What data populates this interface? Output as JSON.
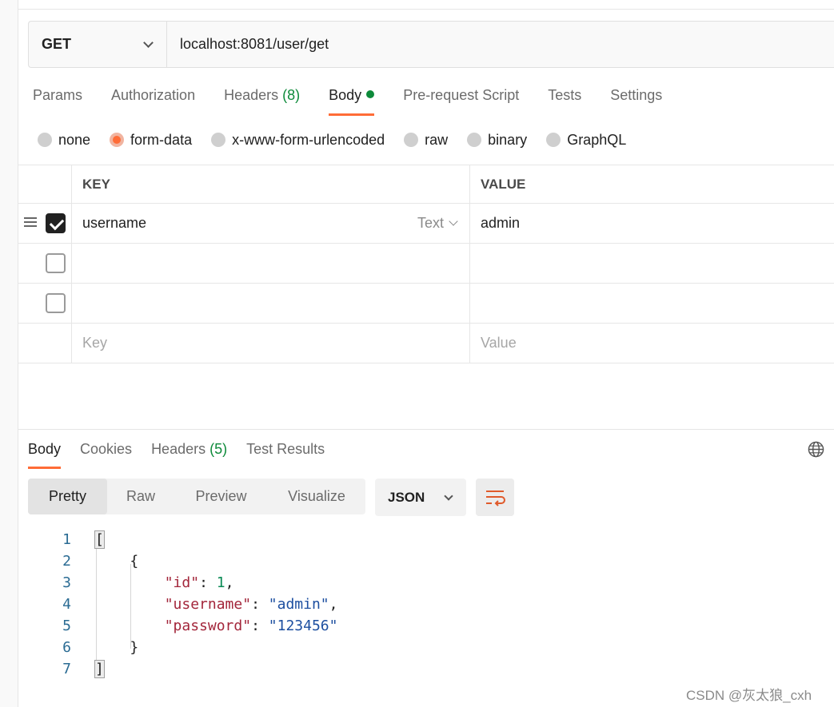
{
  "request": {
    "method": "GET",
    "url": "localhost:8081/user/get"
  },
  "request_tabs": [
    {
      "label": "Params"
    },
    {
      "label": "Authorization"
    },
    {
      "label": "Headers",
      "count": "(8)"
    },
    {
      "label": "Body"
    },
    {
      "label": "Pre-request Script"
    },
    {
      "label": "Tests"
    },
    {
      "label": "Settings"
    }
  ],
  "body_types": [
    "none",
    "form-data",
    "x-www-form-urlencoded",
    "raw",
    "binary",
    "GraphQL"
  ],
  "table": {
    "key_header": "KEY",
    "value_header": "VALUE",
    "rows": [
      {
        "key": "username",
        "type": "Text",
        "value": "admin"
      }
    ],
    "key_placeholder": "Key",
    "value_placeholder": "Value"
  },
  "response_tabs": [
    {
      "label": "Body"
    },
    {
      "label": "Cookies"
    },
    {
      "label": "Headers",
      "count": "(5)"
    },
    {
      "label": "Test Results"
    }
  ],
  "views": [
    "Pretty",
    "Raw",
    "Preview",
    "Visualize"
  ],
  "format": "JSON",
  "code": {
    "line_numbers": [
      "1",
      "2",
      "3",
      "4",
      "5",
      "6",
      "7"
    ],
    "open_bracket": "[",
    "open_brace": "{",
    "fields": [
      {
        "key": "\"id\"",
        "value": "1"
      },
      {
        "key": "\"username\"",
        "value": "\"admin\""
      },
      {
        "key": "\"password\"",
        "value": "\"123456\""
      }
    ],
    "close_brace": "}",
    "close_bracket": "]"
  },
  "watermark": "CSDN @灰太狼_cxh",
  "colors": {
    "accent": "#ff6c37",
    "count_green": "#0d8a3a"
  }
}
